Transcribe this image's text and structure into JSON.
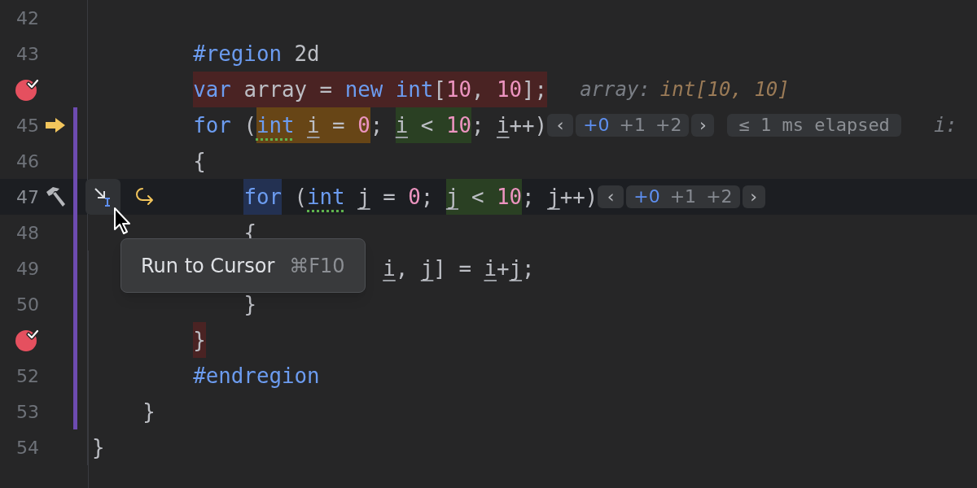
{
  "lines": [
    {
      "number": "42",
      "modified": false,
      "current": false
    },
    {
      "number": "43",
      "modified": false,
      "current": false,
      "tokens": [
        {
          "text": "        #region",
          "kind": "directive"
        },
        {
          "text": " 2d",
          "kind": "plain"
        }
      ]
    },
    {
      "gutter": {
        "kind": "breakpoint"
      },
      "modified": false,
      "current": false,
      "tokens": [
        {
          "text": "        var",
          "kind": "keyword",
          "breakpoint_hit": true
        },
        {
          "text": " array = ",
          "kind": "plain",
          "breakpoint_hit": true
        },
        {
          "text": "new",
          "kind": "keyword",
          "breakpoint_hit": true
        },
        {
          "text": " int",
          "kind": "keyword",
          "breakpoint_hit": true
        },
        {
          "text": "[",
          "kind": "plain",
          "breakpoint_hit": true
        },
        {
          "text": "10",
          "kind": "number",
          "breakpoint_hit": true
        },
        {
          "text": ", ",
          "kind": "plain",
          "breakpoint_hit": true
        },
        {
          "text": "10",
          "kind": "number",
          "breakpoint_hit": true
        },
        {
          "text": "];",
          "kind": "plain",
          "breakpoint_hit": true
        }
      ],
      "hints": [
        {
          "kind": "value",
          "name": "array:",
          "value": "int[10, 10]"
        }
      ]
    },
    {
      "number": "45",
      "gutter": {
        "kind": "execution_arrow"
      },
      "modified": true,
      "current": false,
      "tokens": [
        {
          "text": "        for",
          "kind": "keyword"
        },
        {
          "text": " (",
          "kind": "plain"
        },
        {
          "text": "int",
          "kind": "keyword",
          "executing": true,
          "dotted_underline": true
        },
        {
          "text": " i",
          "kind": "plain",
          "executing": true,
          "underlined": true
        },
        {
          "text": " = ",
          "kind": "plain",
          "executing": true
        },
        {
          "text": "0",
          "kind": "number",
          "executing": true
        },
        {
          "text": "; ",
          "kind": "plain"
        },
        {
          "text": "i",
          "kind": "plain",
          "condition_true": true,
          "underlined": true
        },
        {
          "text": " < ",
          "kind": "plain",
          "condition_true": true
        },
        {
          "text": "10",
          "kind": "number",
          "condition_true": true
        },
        {
          "text": "; ",
          "kind": "plain"
        },
        {
          "text": "i",
          "kind": "plain",
          "underlined": true
        },
        {
          "text": "++)",
          "kind": "plain"
        }
      ],
      "hints": [
        {
          "kind": "iterations",
          "prev": "‹",
          "next": "›",
          "items": [
            {
              "text": "+0",
              "selected": true
            },
            {
              "text": "+1",
              "selected": false
            },
            {
              "text": "+2",
              "selected": false
            }
          ]
        },
        {
          "kind": "badge",
          "text": "≤ 1 ms elapsed"
        },
        {
          "kind": "value",
          "name": "i:"
        }
      ]
    },
    {
      "number": "46",
      "modified": true,
      "current": false,
      "tokens": [
        {
          "text": "        {",
          "kind": "plain"
        }
      ]
    },
    {
      "number": "47",
      "gutter": {
        "kind": "hammer"
      },
      "modified": true,
      "current": true,
      "actions": [
        {
          "kind": "run_to_cursor",
          "hovered": true
        },
        {
          "kind": "step_over",
          "hovered": false
        }
      ],
      "tokens": [
        {
          "text": "            for",
          "kind": "keyword",
          "at_cursor": true
        },
        {
          "text": " (",
          "kind": "plain"
        },
        {
          "text": "int",
          "kind": "keyword",
          "dotted_underline": true
        },
        {
          "text": " j",
          "kind": "plain",
          "underlined": true
        },
        {
          "text": " = ",
          "kind": "plain"
        },
        {
          "text": "0",
          "kind": "number"
        },
        {
          "text": "; ",
          "kind": "plain"
        },
        {
          "text": "j",
          "kind": "plain",
          "condition_true": true,
          "underlined": true
        },
        {
          "text": " < ",
          "kind": "plain",
          "condition_true": true
        },
        {
          "text": "10",
          "kind": "number",
          "condition_true": true
        },
        {
          "text": "; ",
          "kind": "plain"
        },
        {
          "text": "j",
          "kind": "plain",
          "underlined": true
        },
        {
          "text": "++)",
          "kind": "plain"
        }
      ],
      "hints": [
        {
          "kind": "iterations",
          "prev": "‹",
          "next": "›",
          "items": [
            {
              "text": "+0",
              "selected": true
            },
            {
              "text": "+1",
              "selected": false
            },
            {
              "text": "+2",
              "selected": false
            }
          ]
        }
      ]
    },
    {
      "number": "48",
      "modified": true,
      "current": false,
      "tokens": [
        {
          "text": "            {",
          "kind": "plain"
        }
      ]
    },
    {
      "number": "49",
      "modified": true,
      "current": false,
      "tokens": [
        {
          "text": "                       i",
          "kind": "plain",
          "underlined": true
        },
        {
          "text": ", ",
          "kind": "plain"
        },
        {
          "text": "j",
          "kind": "plain",
          "underlined": true
        },
        {
          "text": "] = ",
          "kind": "plain"
        },
        {
          "text": "i",
          "kind": "plain",
          "underlined": true
        },
        {
          "text": "+",
          "kind": "plain"
        },
        {
          "text": "j",
          "kind": "plain",
          "underlined": true
        },
        {
          "text": ";",
          "kind": "plain"
        }
      ]
    },
    {
      "number": "50",
      "modified": true,
      "current": false,
      "tokens": [
        {
          "text": "            }",
          "kind": "plain"
        }
      ]
    },
    {
      "gutter": {
        "kind": "breakpoint"
      },
      "modified": true,
      "current": false,
      "tokens": [
        {
          "text": "        }",
          "kind": "plain",
          "breakpoint_hit": true
        }
      ]
    },
    {
      "number": "52",
      "modified": true,
      "current": false,
      "tokens": [
        {
          "text": "        #endregion",
          "kind": "directive"
        }
      ]
    },
    {
      "number": "53",
      "modified": true,
      "current": false,
      "tokens": [
        {
          "text": "    }",
          "kind": "plain"
        }
      ]
    },
    {
      "number": "54",
      "modified": false,
      "current": false,
      "tokens": [
        {
          "text": "}",
          "kind": "plain"
        }
      ]
    }
  ],
  "tooltip": {
    "title": "Run to Cursor",
    "shortcut": "⌘F10"
  }
}
